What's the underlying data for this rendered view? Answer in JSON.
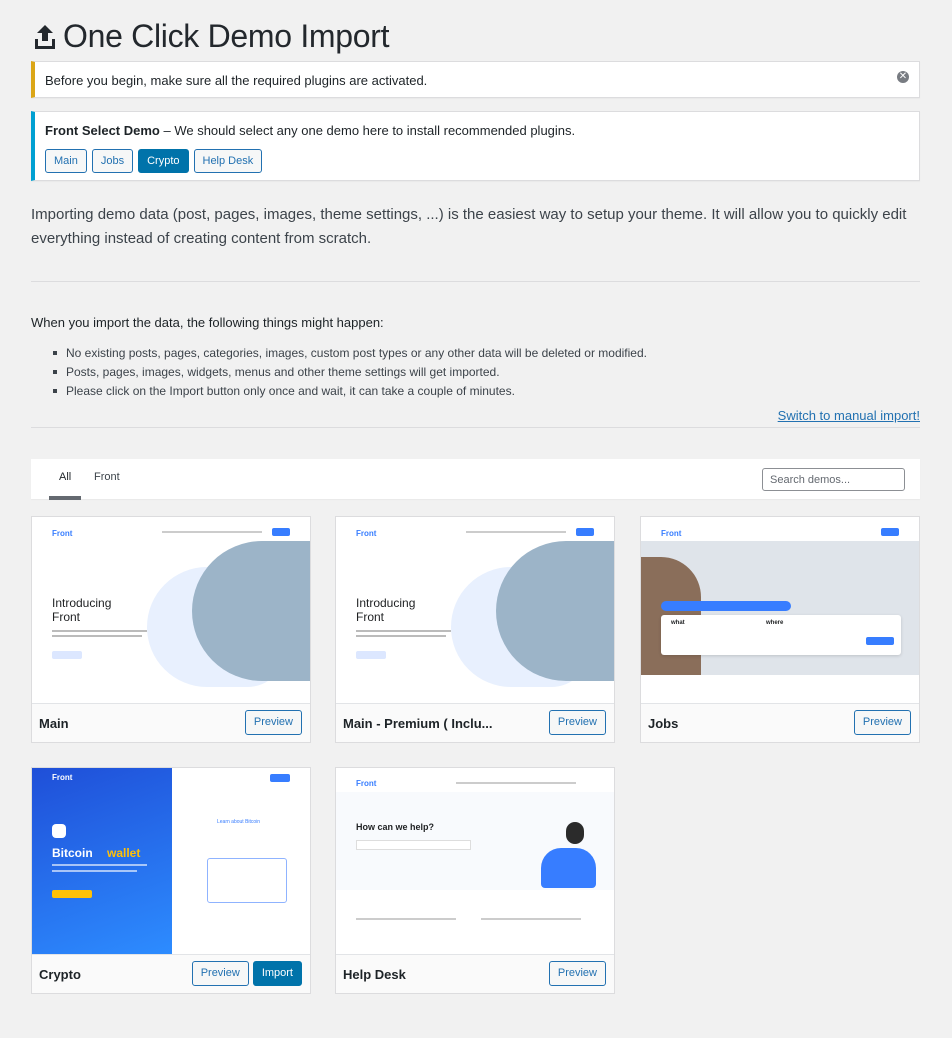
{
  "page": {
    "title": "One Click Demo Import"
  },
  "notices": {
    "warning": "Before you begin, make sure all the required plugins are activated.",
    "dismiss_icon": "close-icon",
    "select_demo_strong": "Front Select Demo",
    "select_demo_text": " – We should select any one demo here to install recommended plugins.",
    "demo_buttons": [
      "Main",
      "Jobs",
      "Crypto",
      "Help Desk"
    ],
    "active_demo": "Crypto"
  },
  "intro": "Importing demo data (post, pages, images, theme settings, ...) is the easiest way to setup your theme. It will allow you to quickly edit everything instead of creating content from scratch.",
  "happen": {
    "title": "When you import the data, the following things might happen:",
    "items": [
      "No existing posts, pages, categories, images, custom post types or any other data will be deleted or modified.",
      "Posts, pages, images, widgets, menus and other theme settings will get imported.",
      "Please click on the Import button only once and wait, it can take a couple of minutes."
    ]
  },
  "manual_link": "Switch to manual import!",
  "filters": {
    "tabs": [
      "All",
      "Front"
    ],
    "active": "All",
    "search_placeholder": "Search demos..."
  },
  "demos": [
    {
      "name": "Main",
      "preview": "Preview",
      "import": null,
      "thumb": {
        "brand": "Front",
        "heading1": "Introducing",
        "heading2": "Front"
      }
    },
    {
      "name": "Main - Premium ( Inclu...",
      "preview": "Preview",
      "import": null,
      "thumb": {
        "brand": "Front",
        "heading1": "Introducing",
        "heading2": "Front"
      }
    },
    {
      "name": "Jobs",
      "preview": "Preview",
      "import": null,
      "thumb": {
        "brand": "Front",
        "what": "what",
        "where": "where"
      }
    },
    {
      "name": "Crypto",
      "preview": "Preview",
      "import": "Import",
      "thumb": {
        "brand": "Front",
        "heading1": "Bitcoin",
        "heading2": "wallet",
        "side": "Learn about Bitcoin"
      }
    },
    {
      "name": "Help Desk",
      "preview": "Preview",
      "import": null,
      "thumb": {
        "brand": "Front",
        "heading": "How can we help?"
      }
    }
  ],
  "colors": {
    "accent": "#0073aa",
    "link": "#2271b1",
    "warning": "#dba617",
    "info": "#00a0d2",
    "front_blue": "#377dff"
  }
}
